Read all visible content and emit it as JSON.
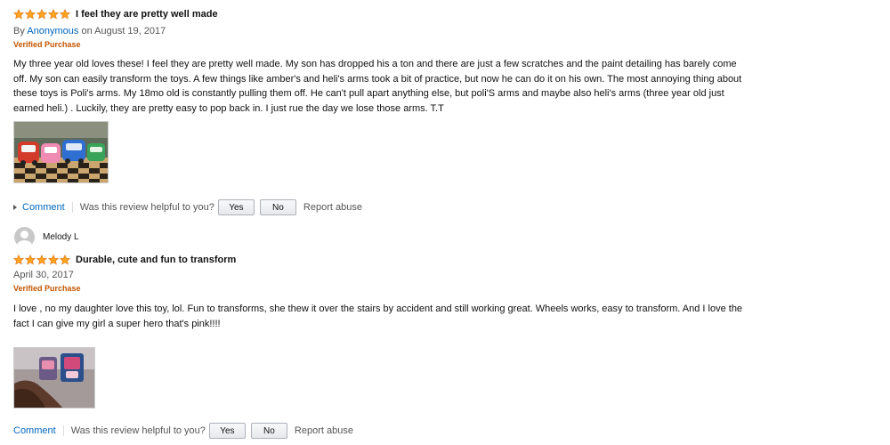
{
  "reviews": [
    {
      "rating": 5,
      "title": "I feel they are pretty well made",
      "by_prefix": "By ",
      "author": "Anonymous",
      "date_text": " on August 19, 2017",
      "verified": "Verified Purchase",
      "body": "My three year old loves these! I feel they are pretty well made. My son has dropped his a ton and there are just a few scratches and the paint detailing has barely come off. My son can easily transform the toys. A few things like amber's and heli's arms took a bit of practice, but now he can do it on his own. The most annoying thing about these toys is Poli's arms. My 18mo old is constantly pulling them off. He can't pull apart anything else, but poli'S arms and maybe also heli's arms (three year old just earned heli.) . Luckily, they are pretty easy to pop back in. I just rue the day we lose those arms. T.T",
      "comment": "Comment",
      "helpful_question": "Was this review helpful to you?",
      "yes": "Yes",
      "no": "No",
      "report": "Report abuse"
    },
    {
      "profile_name": "Melody L",
      "rating": 5,
      "title": "Durable, cute and fun to transform",
      "date": "April 30, 2017",
      "verified": "Verified Purchase",
      "body": "I love , no my daughter love this toy, lol. Fun to transforms, she thew it over the stairs by accident and still working great. Wheels works, easy to transform. And I love the fact I can give my girl a super hero that's pink!!!!",
      "comment": "Comment",
      "helpful_question": "Was this review helpful to you?",
      "yes": "Yes",
      "no": "No",
      "report": "Report abuse"
    }
  ],
  "colors": {
    "star": "#ffa41c",
    "star_edge": "#de7921",
    "link": "#0066c0",
    "verified": "#c45500"
  },
  "icons": {
    "star": "star-icon",
    "avatar": "default-avatar-icon",
    "expand": "triangle-right-icon"
  }
}
